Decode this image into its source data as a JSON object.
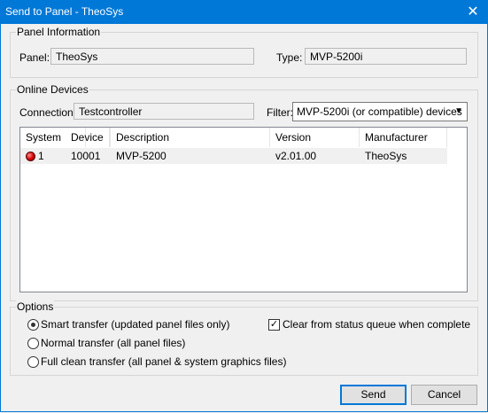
{
  "window": {
    "title": "Send to Panel - TheoSys",
    "close_glyph": "✕"
  },
  "panel_info": {
    "group_label": "Panel Information",
    "panel_label": "Panel:",
    "panel_value": "TheoSys",
    "type_label": "Type:",
    "type_value": "MVP-5200i"
  },
  "online_devices": {
    "group_label": "Online Devices",
    "connection_label": "Connection:",
    "connection_value": "Testcontroller",
    "filter_label": "Filter:",
    "filter_value": "MVP-5200i (or compatible) devices",
    "columns": [
      "System",
      "Device",
      "Description",
      "Version",
      "Manufacturer"
    ],
    "rows": [
      {
        "system": "1",
        "device": "10001",
        "description": "MVP-5200",
        "version": "v2.01.00",
        "manufacturer": "TheoSys",
        "status": "online-red-led"
      }
    ]
  },
  "options": {
    "group_label": "Options",
    "smart_transfer": "Smart transfer (updated panel files only)",
    "normal_transfer": "Normal transfer (all panel files)",
    "full_clean_transfer": "Full clean transfer (all panel & system graphics files)",
    "selected": "smart_transfer",
    "clear_queue_label": "Clear from status queue when complete",
    "clear_queue_checked": true
  },
  "buttons": {
    "send": "Send",
    "cancel": "Cancel"
  },
  "colors": {
    "title_bar": "#0078d7",
    "dialog_bg": "#f0f0f0",
    "default_button_border": "#0078d7"
  }
}
